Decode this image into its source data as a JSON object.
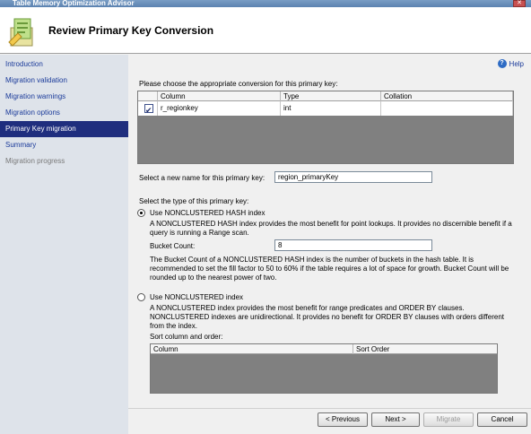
{
  "window": {
    "title": "Table Memory Optimization Advisor"
  },
  "header": {
    "title": "Review Primary Key Conversion"
  },
  "sidebar": {
    "items": [
      {
        "label": "Introduction",
        "state": "normal"
      },
      {
        "label": "Migration validation",
        "state": "normal"
      },
      {
        "label": "Migration warnings",
        "state": "normal"
      },
      {
        "label": "Migration options",
        "state": "normal"
      },
      {
        "label": "Primary Key migration",
        "state": "selected"
      },
      {
        "label": "Summary",
        "state": "normal"
      },
      {
        "label": "Migration progress",
        "state": "disabled"
      }
    ]
  },
  "help": {
    "label": "Help"
  },
  "conversion": {
    "prompt": "Please choose the appropriate conversion for this primary key:",
    "columns": [
      "Column",
      "Type",
      "Collation"
    ],
    "rows": [
      {
        "checked": true,
        "column": "r_regionkey",
        "type": "int",
        "collation": ""
      }
    ]
  },
  "new_name": {
    "label": "Select a new name for this primary key:",
    "value": "region_primaryKey"
  },
  "key_type": {
    "label": "Select the type of this primary key:",
    "hash_option": {
      "label": "Use NONCLUSTERED HASH index",
      "selected": true,
      "description": "A NONCLUSTERED HASH index provides the most benefit for point lookups. It provides no discernible benefit if a query is running a Range scan.",
      "bucket_label": "Bucket Count:",
      "bucket_value": "8",
      "bucket_note": "The Bucket Count of a NONCLUSTERED HASH index is the number of buckets in the hash table. It is recommended to set the fill factor to 50 to 60% if the table requires a lot of space for growth. Bucket Count will be rounded up to the nearest power of two."
    },
    "nonclustered_option": {
      "label": "Use NONCLUSTERED index",
      "selected": false,
      "description": "A NONCLUSTERED index provides the most benefit for range predicates and ORDER BY clauses. NONCLUSTERED indexes are unidirectional. It provides no benefit for ORDER BY clauses with orders different from the index.",
      "sort_label": "Sort column and order:",
      "sort_columns": [
        "Column",
        "Sort Order"
      ]
    }
  },
  "buttons": {
    "previous": "< Previous",
    "next": "Next >",
    "migrate": "Migrate",
    "cancel": "Cancel"
  },
  "colors": {
    "nav_selected_bg": "#1f2e7e",
    "nav_link": "#1a3a9a",
    "sidebar_bg": "#dee3ea",
    "grid_empty": "#808080"
  }
}
